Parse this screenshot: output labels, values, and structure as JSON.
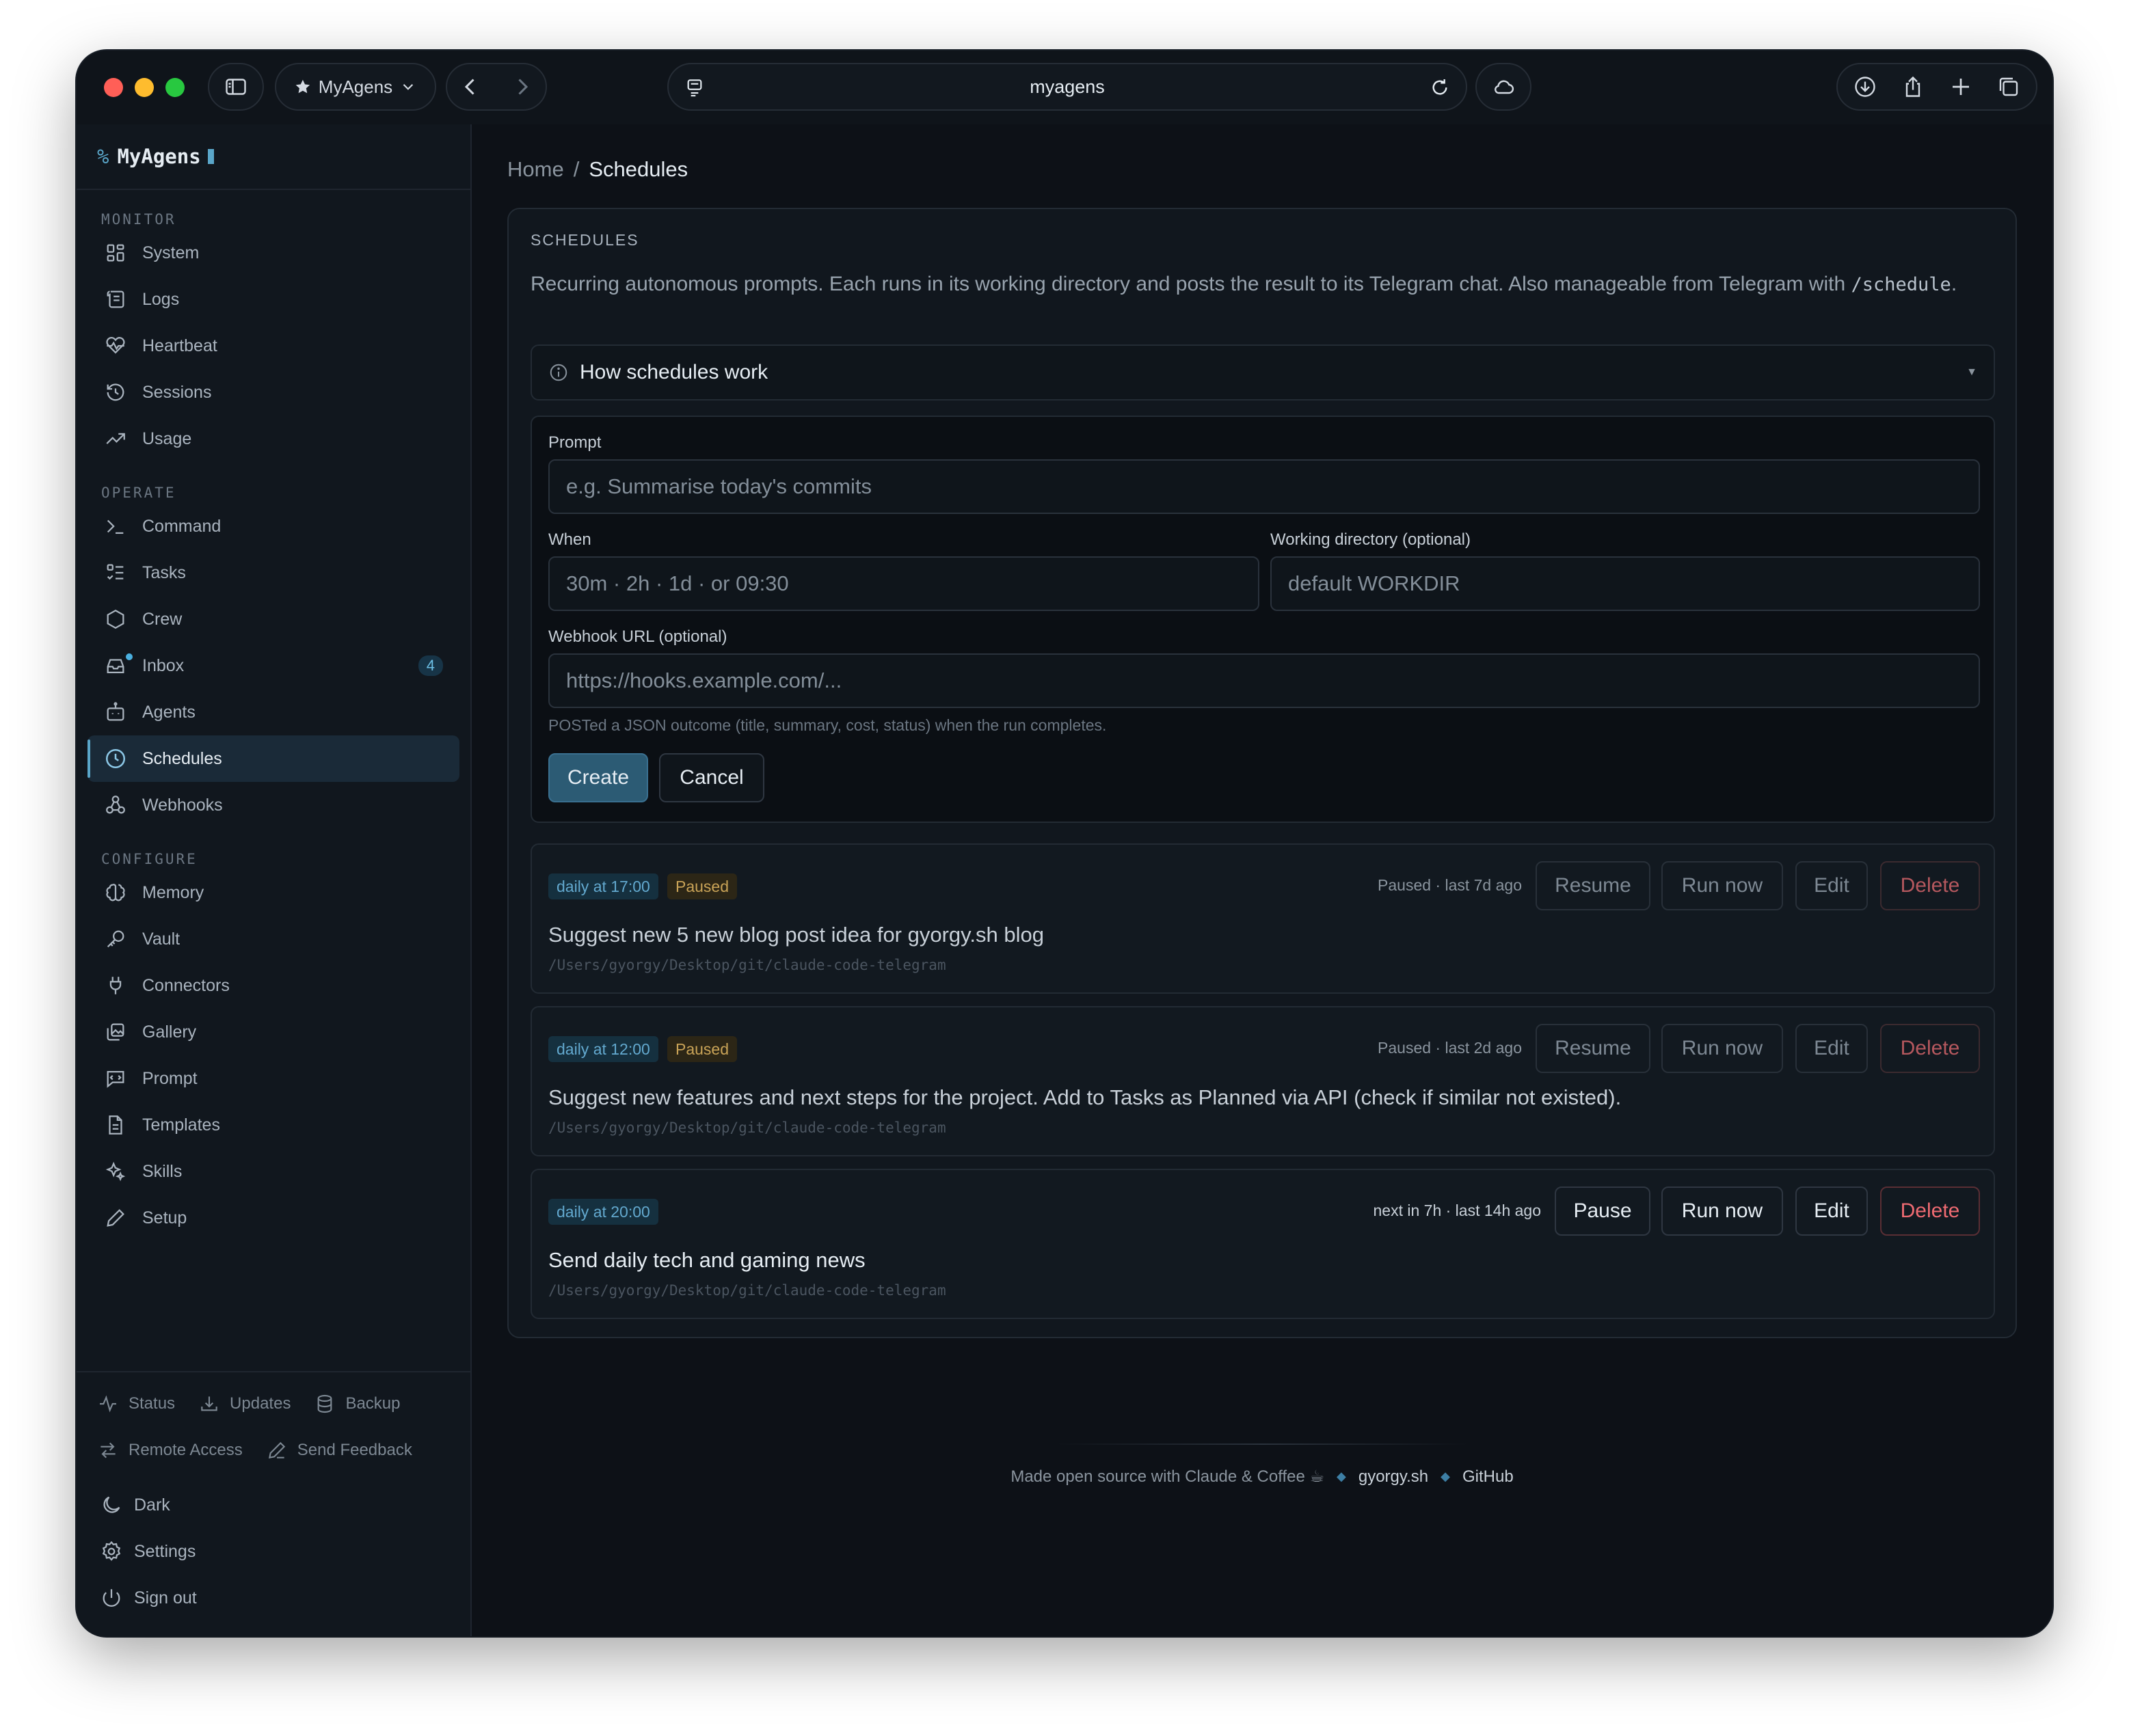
{
  "browser": {
    "profile_label": "MyAgens",
    "url": "myagens"
  },
  "sidebar": {
    "brand": "MyAgens",
    "brand_prefix": "%",
    "monitor_label": "MONITOR",
    "monitor_items": [
      {
        "label": "System",
        "icon": "grid-icon"
      },
      {
        "label": "Logs",
        "icon": "scroll-icon"
      },
      {
        "label": "Heartbeat",
        "icon": "heart-pulse-icon"
      },
      {
        "label": "Sessions",
        "icon": "history-icon"
      },
      {
        "label": "Usage",
        "icon": "trend-icon"
      }
    ],
    "operate_label": "OPERATE",
    "operate_items": [
      {
        "label": "Command",
        "icon": "terminal-icon"
      },
      {
        "label": "Tasks",
        "icon": "checklist-icon"
      },
      {
        "label": "Crew",
        "icon": "hexagon-icon"
      },
      {
        "label": "Inbox",
        "icon": "inbox-icon",
        "badge": "4"
      },
      {
        "label": "Agents",
        "icon": "bot-icon"
      },
      {
        "label": "Schedules",
        "icon": "clock-icon",
        "active": true
      },
      {
        "label": "Webhooks",
        "icon": "webhook-icon"
      }
    ],
    "configure_label": "CONFIGURE",
    "configure_items": [
      {
        "label": "Memory",
        "icon": "brain-icon"
      },
      {
        "label": "Vault",
        "icon": "key-icon"
      },
      {
        "label": "Connectors",
        "icon": "plug-icon"
      },
      {
        "label": "Gallery",
        "icon": "gallery-icon"
      },
      {
        "label": "Prompt",
        "icon": "message-icon"
      },
      {
        "label": "Templates",
        "icon": "document-icon"
      },
      {
        "label": "Skills",
        "icon": "sparkles-icon"
      },
      {
        "label": "Setup",
        "icon": "pencil-icon"
      }
    ],
    "footer": {
      "status": "Status",
      "updates": "Updates",
      "backup": "Backup",
      "remote_access": "Remote Access",
      "send_feedback": "Send Feedback",
      "dark": "Dark",
      "settings": "Settings",
      "sign_out": "Sign out"
    }
  },
  "breadcrumb": {
    "home": "Home",
    "separator": "/",
    "current": "Schedules"
  },
  "panel": {
    "title": "SCHEDULES",
    "description": "Recurring autonomous prompts. Each runs in its working directory and posts the result to its Telegram chat. Also manageable from Telegram with",
    "command": "/schedule",
    "description_end": ".",
    "howto_label": "How schedules work"
  },
  "form": {
    "prompt_label": "Prompt",
    "prompt_placeholder": "e.g. Summarise today's commits",
    "when_label": "When",
    "when_placeholder": "30m · 2h · 1d · or 09:30",
    "workdir_label": "Working directory (optional)",
    "workdir_placeholder": "default WORKDIR",
    "webhook_label": "Webhook URL (optional)",
    "webhook_placeholder": "https://hooks.example.com/...",
    "webhook_hint": "POSTed a JSON outcome (title, summary, cost, status) when the run completes.",
    "create_label": "Create",
    "cancel_label": "Cancel"
  },
  "schedules": [
    {
      "when": "daily at 17:00",
      "status_chip": "Paused",
      "meta": "Paused · last 7d ago",
      "toggle_label": "Resume",
      "run_label": "Run now",
      "edit_label": "Edit",
      "delete_label": "Delete",
      "prompt": "Suggest new 5 new blog post idea for gyorgy.sh blog",
      "path": "/Users/gyorgy/Desktop/git/claude-code-telegram"
    },
    {
      "when": "daily at 12:00",
      "status_chip": "Paused",
      "meta": "Paused · last 2d ago",
      "toggle_label": "Resume",
      "run_label": "Run now",
      "edit_label": "Edit",
      "delete_label": "Delete",
      "prompt": "Suggest new features and next steps for the project. Add to Tasks as Planned via API (check if similar not existed).",
      "path": "/Users/gyorgy/Desktop/git/claude-code-telegram"
    },
    {
      "when": "daily at 20:00",
      "meta": "next in 7h · last 14h ago",
      "toggle_label": "Pause",
      "run_label": "Run now",
      "edit_label": "Edit",
      "delete_label": "Delete",
      "prompt": "Send daily tech and gaming news",
      "path": "/Users/gyorgy/Desktop/git/claude-code-telegram"
    }
  ],
  "footer": {
    "made_with": "Made open source with Claude & Coffee ☕",
    "link1": "gyorgy.sh",
    "link2": "GitHub",
    "separator": "◆"
  },
  "colors": {
    "accent": "#5aa6c9",
    "background": "#0d1117",
    "sidebar": "#11171e",
    "danger": "#ef6b72",
    "paused": "#c9a357"
  }
}
